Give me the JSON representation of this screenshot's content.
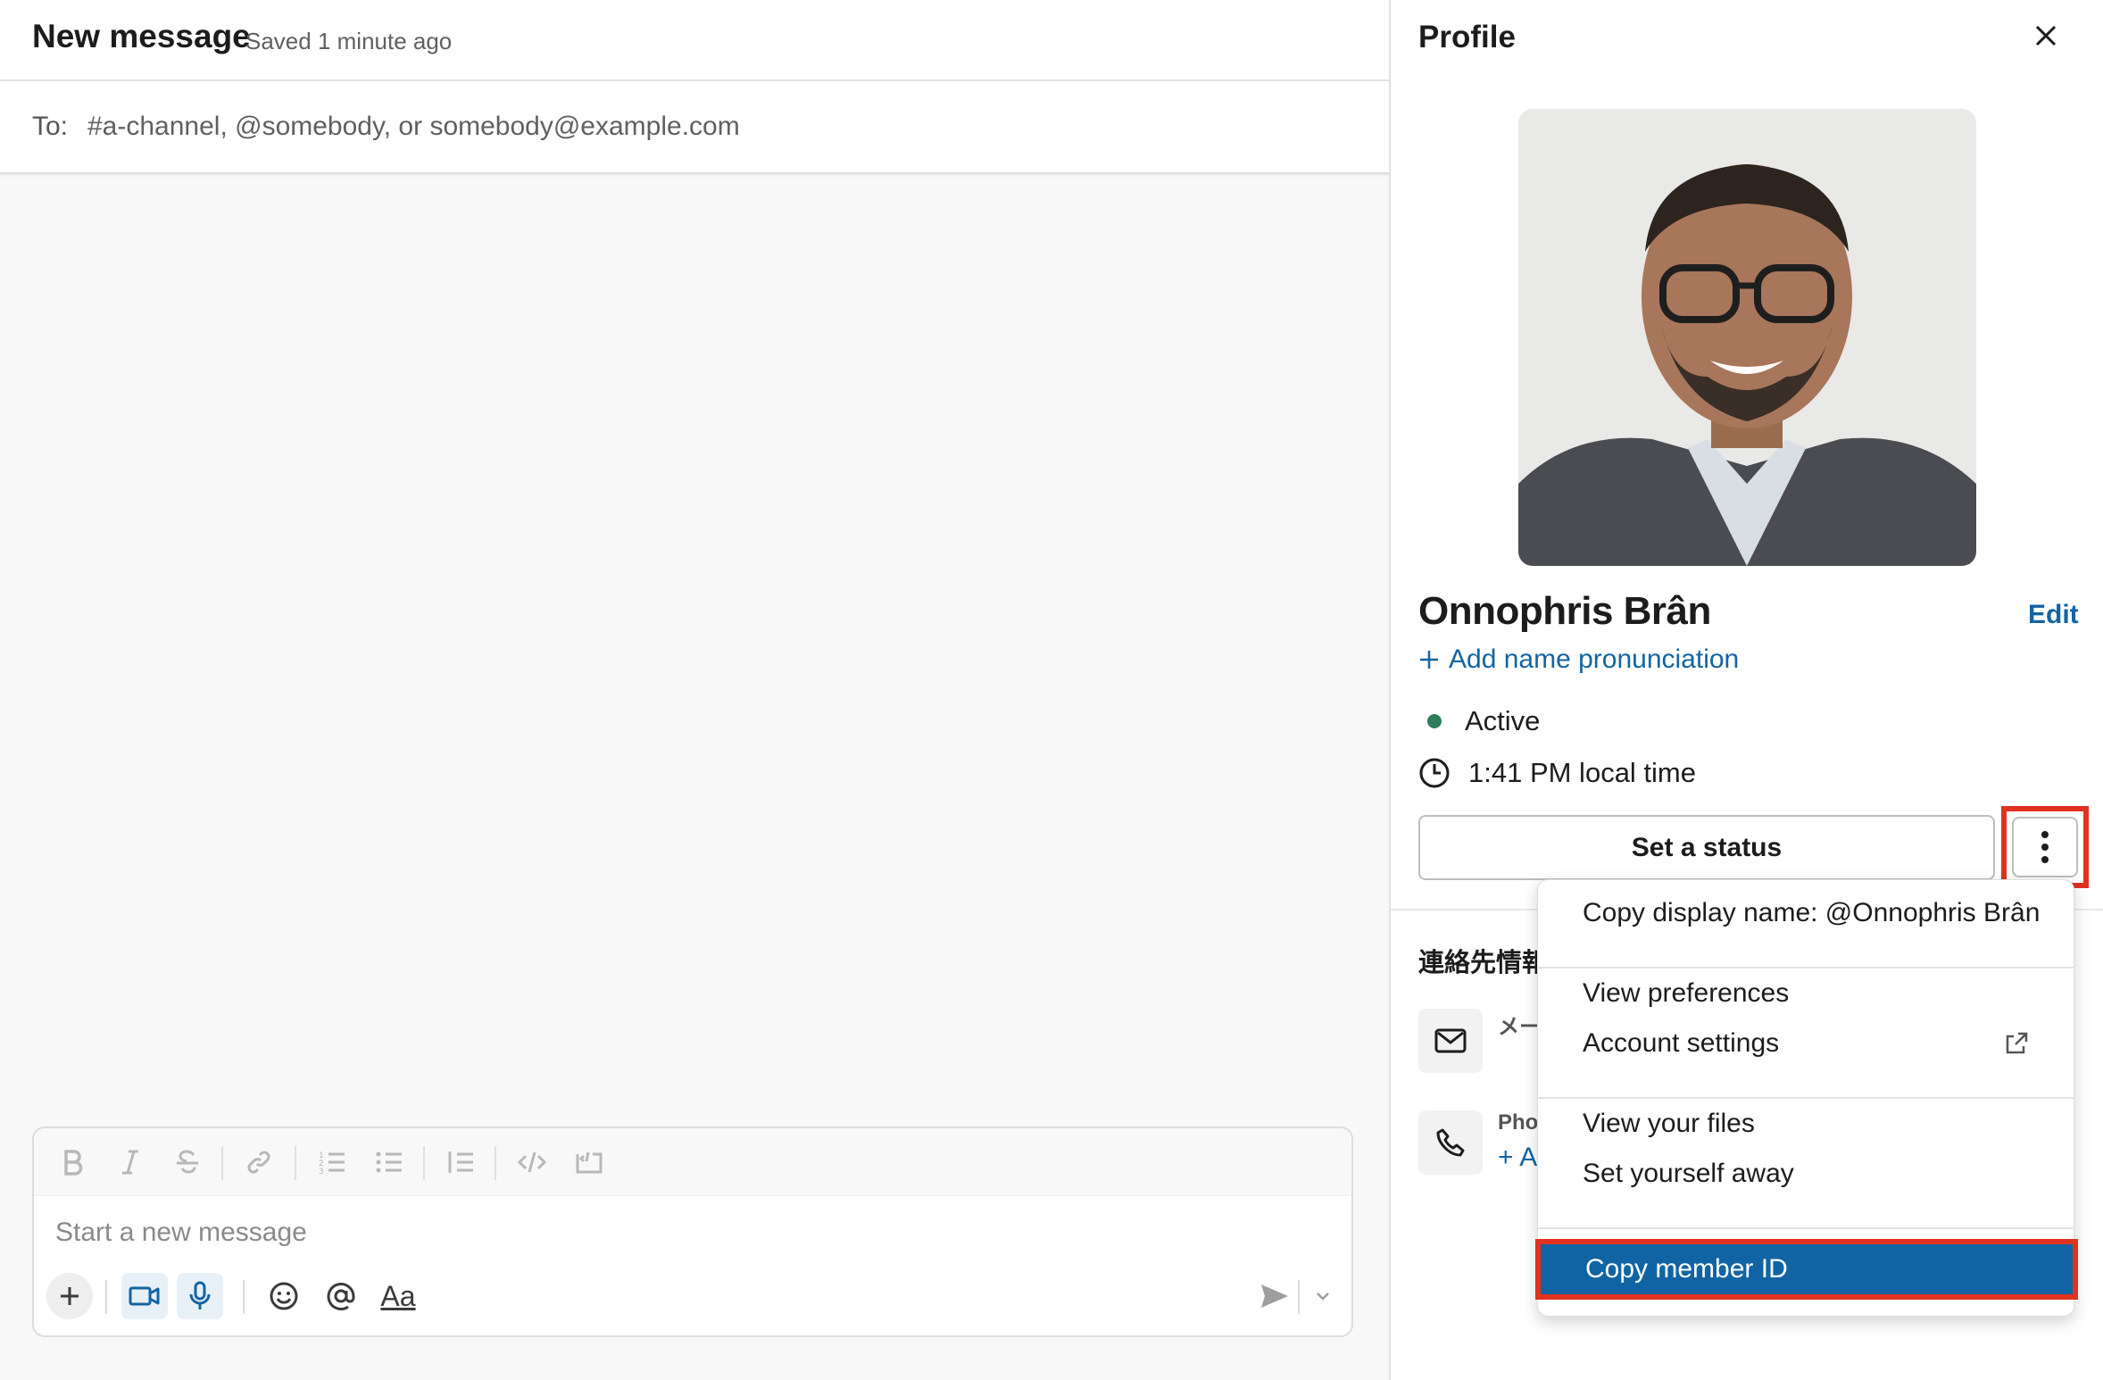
{
  "compose": {
    "title": "New message",
    "saved_status": "Saved 1 minute ago",
    "to_label": "To:",
    "to_placeholder": "#a-channel, @somebody, or somebody@example.com",
    "message_placeholder": "Start a new message",
    "text_style_label": "Aa"
  },
  "profile": {
    "title": "Profile",
    "name": "Onnophris Brân",
    "edit_label": "Edit",
    "add_pronunciation": "Add name pronunciation",
    "presence": "Active",
    "local_time": "1:41 PM local time",
    "set_status": "Set a status",
    "contact_heading": "連絡先情報",
    "email_label": "メールアドレス",
    "phone_label": "Phone",
    "add_phone": "+ Add phone"
  },
  "menu": {
    "copy_display_name": "Copy display name: @Onnophris Brân",
    "view_preferences": "View preferences",
    "account_settings": "Account settings",
    "view_files": "View your files",
    "set_away": "Set yourself away",
    "copy_member_id": "Copy member ID"
  },
  "colors": {
    "link_blue": "#1264a3",
    "highlight_blue": "#1164a3",
    "annotation_red": "#e0321f",
    "active_green": "#2e7d5b"
  }
}
